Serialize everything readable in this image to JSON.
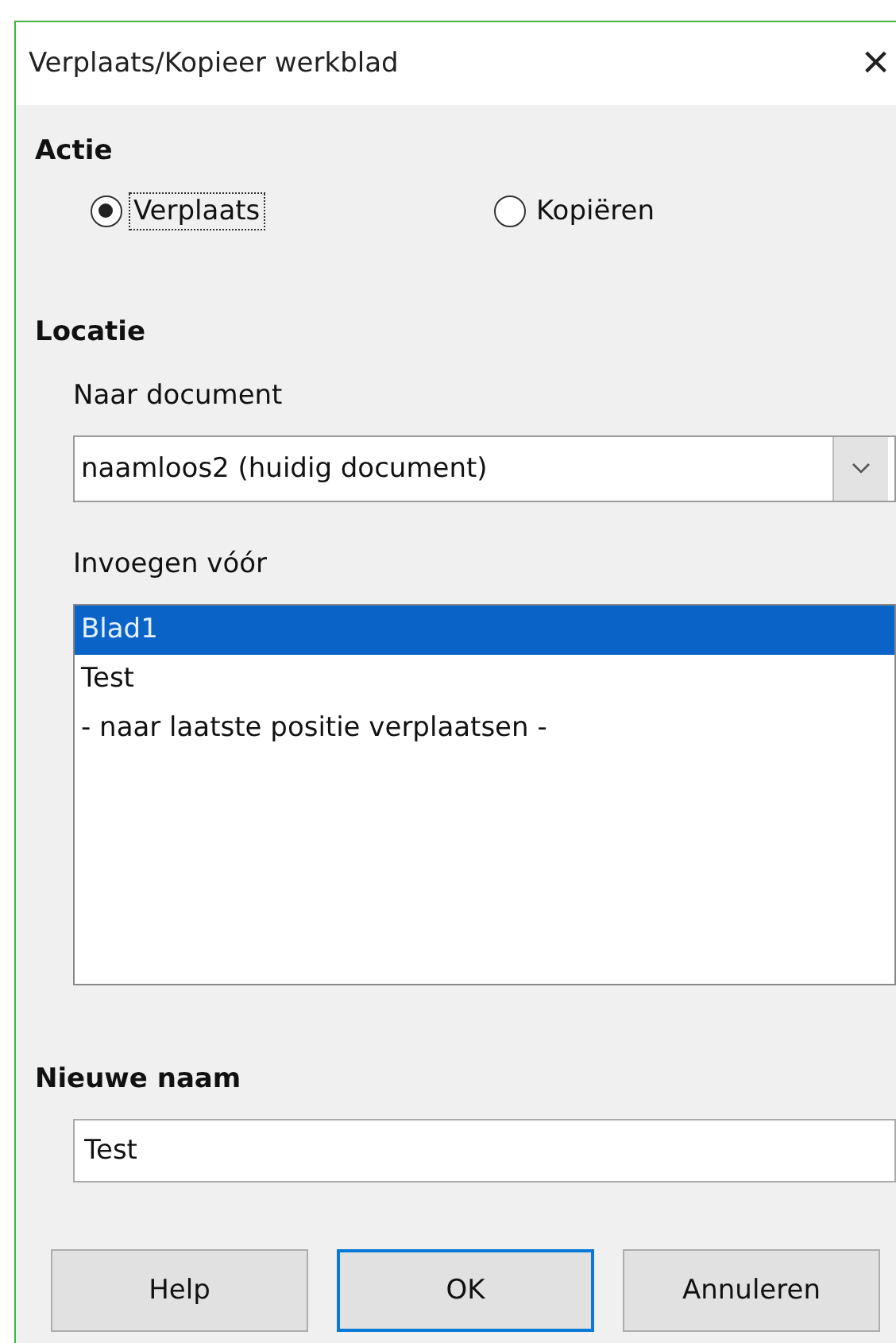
{
  "window": {
    "title": "Verplaats/Kopieer werkblad",
    "close": "×"
  },
  "action": {
    "heading": "Actie",
    "options": [
      {
        "label": "Verplaats",
        "selected": true
      },
      {
        "label": "Kopiëren",
        "selected": false
      }
    ]
  },
  "location": {
    "heading": "Locatie",
    "document_label": "Naar document",
    "document_value": "naamloos2 (huidig document)",
    "insert_label": "Invoegen vóór",
    "items": [
      {
        "label": "Blad1",
        "selected": true
      },
      {
        "label": "Test",
        "selected": false
      },
      {
        "label": "- naar laatste positie verplaatsen -",
        "selected": false
      }
    ]
  },
  "new_name": {
    "heading": "Nieuwe naam",
    "value": "Test"
  },
  "buttons": [
    {
      "label": "Help",
      "default": false
    },
    {
      "label": "OK",
      "default": true
    },
    {
      "label": "Annuleren",
      "default": false
    }
  ]
}
